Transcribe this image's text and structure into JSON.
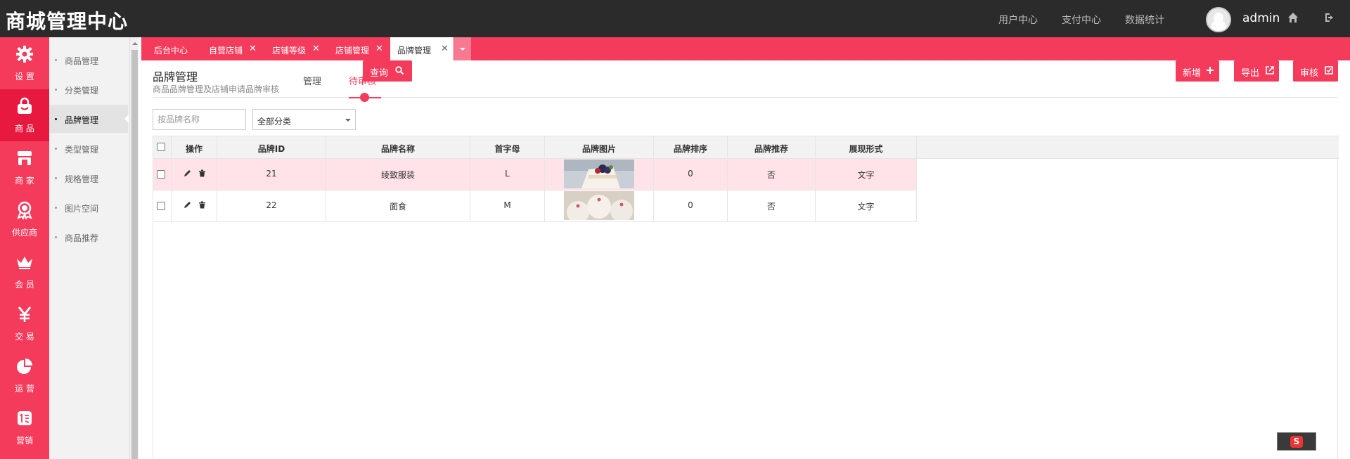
{
  "header": {
    "logo": "商城管理中心",
    "nav": [
      "用户中心",
      "支付中心",
      "数据统计"
    ],
    "username": "admin"
  },
  "sidebar": {
    "items": [
      {
        "label": "设 置",
        "icon": "gear-icon"
      },
      {
        "label": "商 品",
        "icon": "shopping-bag-icon"
      },
      {
        "label": "商 家",
        "icon": "store-icon"
      },
      {
        "label": "供应商",
        "icon": "award-ribbon-icon"
      },
      {
        "label": "会 员",
        "icon": "crown-icon"
      },
      {
        "label": "交 易",
        "icon": "yen-icon"
      },
      {
        "label": "运 营",
        "icon": "pie-chart-icon"
      },
      {
        "label": "营销",
        "icon": "promo-icon"
      }
    ]
  },
  "submenu": {
    "items": [
      "商品管理",
      "分类管理",
      "品牌管理",
      "类型管理",
      "规格管理",
      "图片空间",
      "商品推荐"
    ]
  },
  "tabs": [
    "后台中心",
    "自营店铺",
    "店铺等级",
    "店铺管理",
    "品牌管理"
  ],
  "page": {
    "title": "品牌管理",
    "subtitle": "商品品牌管理及店铺申请品牌审核",
    "subtabs": [
      "管理",
      "待审核"
    ]
  },
  "toolbar": {
    "search_placeholder": "按品牌名称",
    "category_select": "全部分类",
    "query_label": "查询",
    "add_label": "新增",
    "export_label": "导出",
    "review_label": "审核"
  },
  "table": {
    "headers": [
      "操作",
      "品牌ID",
      "品牌名称",
      "首字母",
      "品牌图片",
      "品牌排序",
      "品牌推荐",
      "展现形式"
    ],
    "rows": [
      {
        "id": "21",
        "name": "绫致服装",
        "initial": "L",
        "sort": "0",
        "recommend": "否",
        "display": "文字"
      },
      {
        "id": "22",
        "name": "面食",
        "initial": "M",
        "sort": "0",
        "recommend": "否",
        "display": "文字"
      }
    ]
  },
  "colors": {
    "accent": "#f43b5b",
    "topbar": "#2b2b2b",
    "row_highlight": "#ffe3e8"
  }
}
